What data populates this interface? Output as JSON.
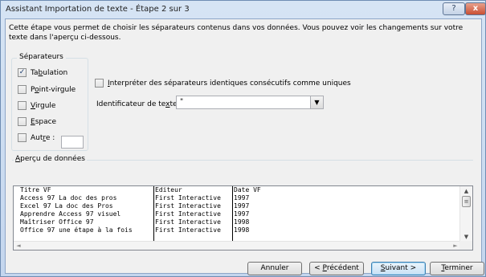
{
  "window": {
    "title": "Assistant Importation de texte - Étape 2 sur 3",
    "help_label": "?",
    "close_label": "x"
  },
  "intro": "Cette étape vous permet de choisir les séparateurs contenus dans vos données. Vous pouvez voir les changements sur votre texte dans l'aperçu ci-dessous.",
  "separators": {
    "title": "Séparateurs",
    "items": [
      {
        "pre": "Ta",
        "key": "b",
        "post": "ulation",
        "checked": true
      },
      {
        "pre": "P",
        "key": "o",
        "post": "int-virgule",
        "checked": false
      },
      {
        "pre": "",
        "key": "V",
        "post": "irgule",
        "checked": false
      },
      {
        "pre": "",
        "key": "E",
        "post": "space",
        "checked": false
      },
      {
        "pre": "Aut",
        "key": "r",
        "post": "e :",
        "checked": false
      }
    ],
    "autre_value": ""
  },
  "consecutive": {
    "pre": "",
    "key": "I",
    "post": "nterpréter des séparateurs identiques consécutifs comme uniques",
    "checked": false
  },
  "text_qualifier": {
    "label_pre": "Identificateur de te",
    "label_key": "x",
    "label_post": "te :",
    "value": "\"",
    "arrow": "▼"
  },
  "preview": {
    "title_pre": "",
    "title_key": "A",
    "title_post": "perçu de données",
    "rows": [
      [
        "Titre VF",
        "Editeur",
        "Date VF"
      ],
      [
        "Access 97 La doc des pros",
        "First Interactive",
        "1997"
      ],
      [
        "Excel 97 La doc des Pros",
        "First Interactive",
        "1997"
      ],
      [
        "Apprendre Access 97 visuel",
        "First Interactive",
        "1997"
      ],
      [
        "Maîtriser Office 97",
        "First Interactive",
        "1998"
      ],
      [
        "Office 97 une étape à la fois",
        "First Interactive",
        "1998"
      ]
    ],
    "scroll_up": "▲",
    "scroll_down": "▼",
    "scroll_left": "◄",
    "scroll_right": "►",
    "thumb_grip": "≡"
  },
  "buttons": {
    "cancel": {
      "pre": "Annuler",
      "key": "",
      "post": ""
    },
    "previous": {
      "pre": "< ",
      "key": "P",
      "post": "récédent"
    },
    "next": {
      "pre": "",
      "key": "S",
      "post": "uivant >"
    },
    "finish": {
      "pre": "",
      "key": "T",
      "post": "erminer"
    }
  },
  "colors": {
    "accent": "#3c7fb1",
    "close_button": "#c94f33"
  }
}
